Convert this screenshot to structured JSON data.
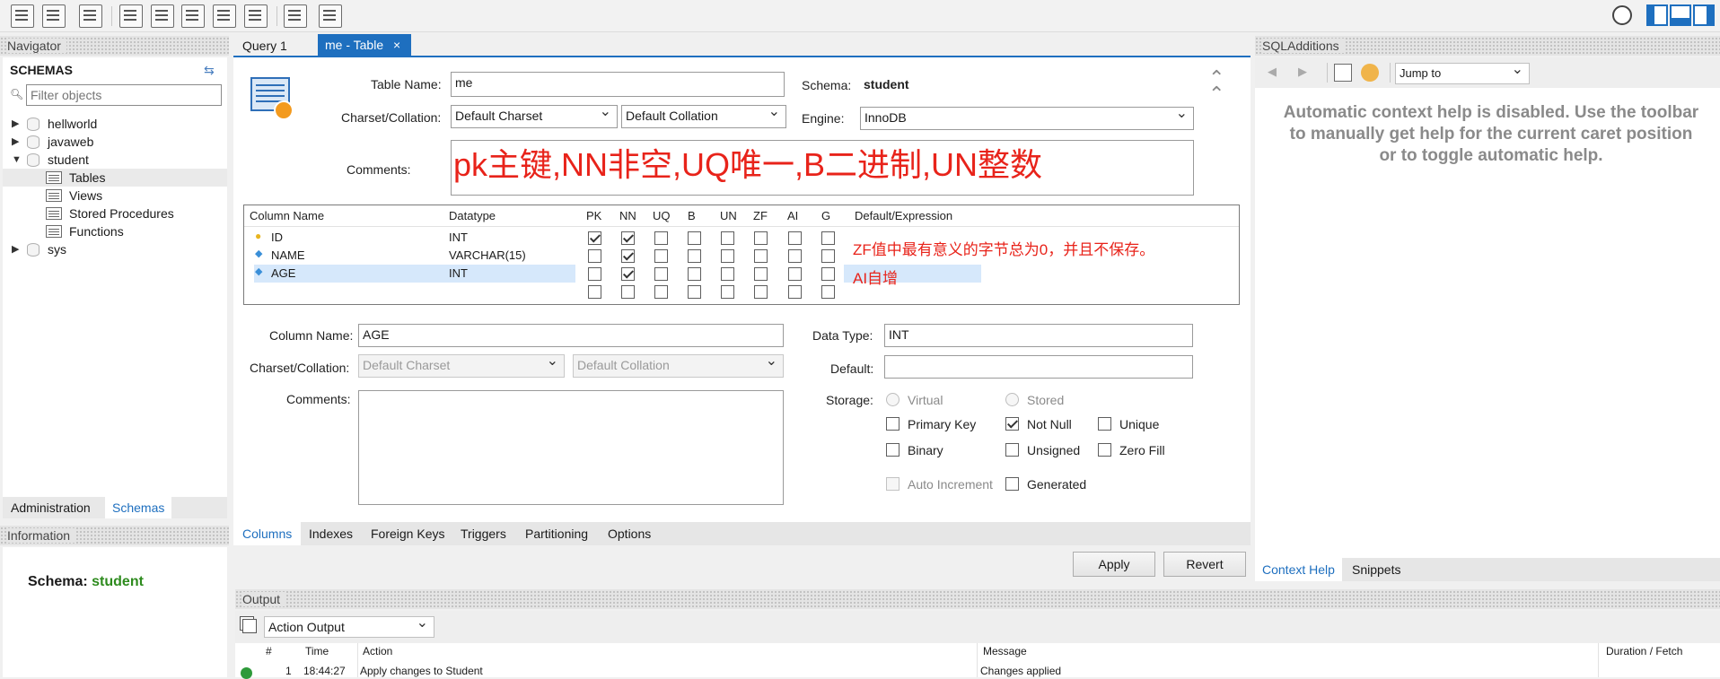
{
  "navigator": {
    "title": "Navigator",
    "schemas_title": "SCHEMAS",
    "filter_placeholder": "Filter objects",
    "tree": [
      {
        "label": "hellworld"
      },
      {
        "label": "javaweb"
      },
      {
        "label": "student"
      },
      {
        "label": "Tables"
      },
      {
        "label": "Views"
      },
      {
        "label": "Stored Procedures"
      },
      {
        "label": "Functions"
      },
      {
        "label": "sys"
      }
    ],
    "bottom_tabs": [
      "Administration",
      "Schemas"
    ]
  },
  "information": {
    "title": "Information",
    "schema_label": "Schema:",
    "schema_value": "student"
  },
  "editor_tabs": [
    "Query 1",
    "me - Table"
  ],
  "table_form": {
    "table_name_label": "Table Name:",
    "table_name": "me",
    "schema_label": "Schema:",
    "schema": "student",
    "charset_label": "Charset/Collation:",
    "charset": "Default Charset",
    "collation": "Default Collation",
    "engine_label": "Engine:",
    "engine": "InnoDB",
    "comments_label": "Comments:",
    "comments": "pk主键,NN非空,UQ唯一,B二进制,UN整数"
  },
  "columns_grid": {
    "headers": [
      "Column Name",
      "Datatype",
      "PK",
      "NN",
      "UQ",
      "B",
      "UN",
      "ZF",
      "AI",
      "G",
      "Default/Expression"
    ],
    "rows": [
      {
        "name": "ID",
        "type": "INT",
        "flags": [
          true,
          true,
          false,
          false,
          false,
          false,
          false,
          false
        ]
      },
      {
        "name": "NAME",
        "type": "VARCHAR(15)",
        "flags": [
          false,
          true,
          false,
          false,
          false,
          false,
          false,
          false
        ]
      },
      {
        "name": "AGE",
        "type": "INT",
        "flags": [
          false,
          true,
          false,
          false,
          false,
          false,
          false,
          false
        ]
      },
      {
        "name": "",
        "type": "",
        "flags": [
          false,
          false,
          false,
          false,
          false,
          false,
          false,
          false
        ]
      }
    ],
    "note1": "ZF值中最有意义的字节总为0，并且不保存。",
    "note2": "AI自增"
  },
  "column_detail": {
    "column_name_label": "Column Name:",
    "column_name": "AGE",
    "charset_label": "Charset/Collation:",
    "charset": "Default Charset",
    "collation": "Default Collation",
    "comments_label": "Comments:",
    "data_type_label": "Data Type:",
    "data_type": "INT",
    "default_label": "Default:",
    "storage_label": "Storage:",
    "virtual": "Virtual",
    "stored": "Stored",
    "primary_key": "Primary Key",
    "not_null": "Not Null",
    "unique": "Unique",
    "binary": "Binary",
    "unsigned": "Unsigned",
    "zero_fill": "Zero Fill",
    "auto_increment": "Auto Increment",
    "generated": "Generated"
  },
  "bottom_tabs": [
    "Columns",
    "Indexes",
    "Foreign Keys",
    "Triggers",
    "Partitioning",
    "Options"
  ],
  "buttons": {
    "apply": "Apply",
    "revert": "Revert"
  },
  "sql_additions": {
    "title": "SQLAdditions",
    "jump_to": "Jump to",
    "help_text": "Automatic context help is disabled. Use the toolbar to manually get help for the current caret position or to toggle automatic help.",
    "tabs": [
      "Context Help",
      "Snippets"
    ]
  },
  "output": {
    "title": "Output",
    "selector": "Action Output",
    "headers": [
      "#",
      "Time",
      "Action",
      "Message",
      "Duration / Fetch"
    ],
    "row": {
      "num": "1",
      "time": "18:44:27",
      "action": "Apply changes to Student",
      "message": "Changes applied"
    }
  },
  "colors": {
    "accent": "#1e6fbf",
    "note_red": "#e8231a",
    "schema_green": "#2e8b1e"
  }
}
